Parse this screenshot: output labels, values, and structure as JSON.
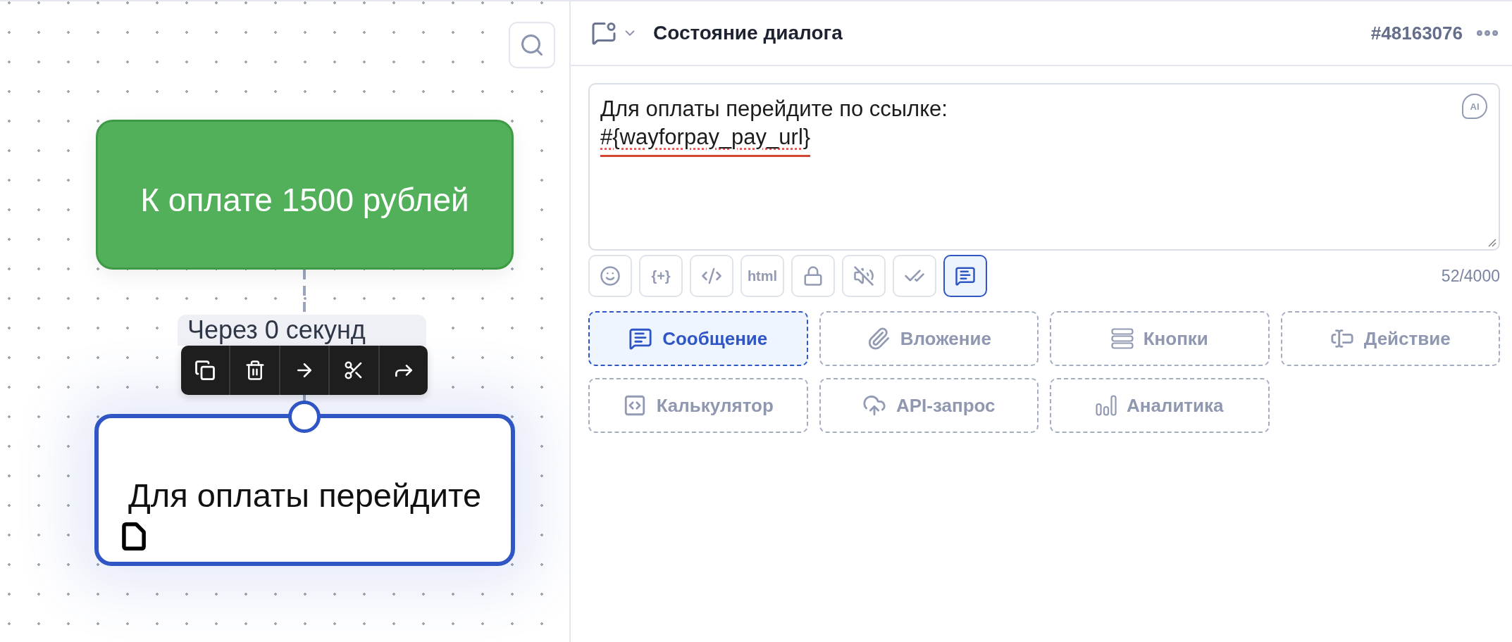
{
  "canvas": {
    "nodes": [
      {
        "kind": "filled",
        "text": "К оплате 1500 рублей",
        "selected": false
      },
      {
        "kind": "message",
        "text": "Для оплаты перейдите",
        "selected": true
      }
    ],
    "delay_label": "Через 0 секунд"
  },
  "panel": {
    "title": "Состояние диалога",
    "dialog_id": "#48163076",
    "message": {
      "lines": [
        {
          "text": "Для оплаты перейдите по ссылке:",
          "flagged": false
        },
        {
          "text": "#{wayforpay_pay_url}",
          "flagged": true
        }
      ],
      "ai_label": "AI",
      "counter": "52/4000"
    },
    "format_tools": [
      {
        "kind": "emoji",
        "selected": false
      },
      {
        "kind": "variable",
        "label": "{+}",
        "selected": false
      },
      {
        "kind": "code",
        "selected": false
      },
      {
        "kind": "html",
        "label": "html",
        "selected": false
      },
      {
        "kind": "lock",
        "selected": false
      },
      {
        "kind": "mute",
        "selected": false
      },
      {
        "kind": "read",
        "selected": false
      },
      {
        "kind": "message",
        "selected": true
      }
    ],
    "block_types": [
      {
        "kind": "message",
        "label": "Сообщение",
        "selected": true
      },
      {
        "kind": "attachment",
        "label": "Вложение",
        "selected": false
      },
      {
        "kind": "buttons",
        "label": "Кнопки",
        "selected": false
      },
      {
        "kind": "action",
        "label": "Действие",
        "selected": false
      },
      {
        "kind": "calculator",
        "label": "Калькулятор",
        "selected": false
      },
      {
        "kind": "api",
        "label": "API-запрос",
        "selected": false
      },
      {
        "kind": "analytics",
        "label": "Аналитика",
        "selected": false
      }
    ]
  }
}
